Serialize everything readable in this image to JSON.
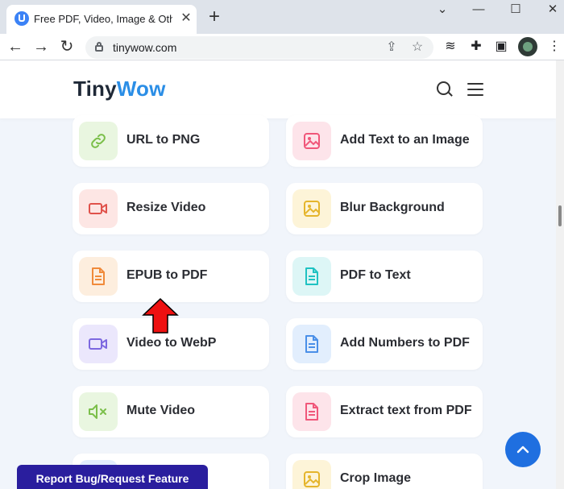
{
  "browser": {
    "tab_title": "Free PDF, Video, Image & Other Online Tools",
    "tab_close": "✕",
    "new_tab": "+",
    "url": "tinywow.com",
    "window_controls": {
      "minimize": "—",
      "maximize": "☐",
      "close": "✕"
    },
    "nav": {
      "back": "←",
      "forward": "→",
      "reload": "↻"
    }
  },
  "site": {
    "logo_part1": "Tiny",
    "logo_part2": "Wow",
    "brand_color": "#2b8ee6"
  },
  "tools": [
    {
      "label": "URL to PNG",
      "icon": "link-icon",
      "color": "#7bbf4a",
      "bg": "#e9f6e0"
    },
    {
      "label": "Add Text to an Image",
      "icon": "image-icon",
      "color": "#f0577a",
      "bg": "#fde4ea"
    },
    {
      "label": "Resize Video",
      "icon": "video-icon",
      "color": "#e0524b",
      "bg": "#fde6e4"
    },
    {
      "label": "Blur Background",
      "icon": "image-icon",
      "color": "#e5b52c",
      "bg": "#fdf4d8"
    },
    {
      "label": "EPUB to PDF",
      "icon": "file-icon",
      "color": "#f08a3a",
      "bg": "#fdeede"
    },
    {
      "label": "PDF to Text",
      "icon": "file-icon",
      "color": "#1fc2c2",
      "bg": "#ddf6f6"
    },
    {
      "label": "Video to WebP",
      "icon": "video-icon",
      "color": "#7c68e0",
      "bg": "#ebe7fc"
    },
    {
      "label": "Add Numbers to PDF",
      "icon": "file-icon",
      "color": "#4a8fe8",
      "bg": "#e2eefd"
    },
    {
      "label": "Mute Video",
      "icon": "mute-icon",
      "color": "#7bbf4a",
      "bg": "#e9f6e0"
    },
    {
      "label": "Extract text from PDF",
      "icon": "file-icon",
      "color": "#f0577a",
      "bg": "#fde4ea"
    },
    {
      "label": "",
      "icon": "video-icon",
      "color": "#4a8fe8",
      "bg": "#e2eefd"
    },
    {
      "label": "Crop Image",
      "icon": "image-icon",
      "color": "#e5b52c",
      "bg": "#fdf4d8"
    }
  ],
  "report_button": "Report Bug/Request Feature",
  "scroll_top_icon": "chevron-up-icon"
}
